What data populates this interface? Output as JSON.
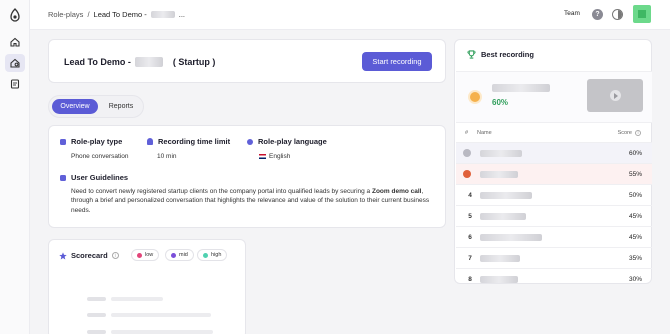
{
  "topbar": {
    "breadcrumb_root": "Role-plays",
    "breadcrumb_sep": "/",
    "breadcrumb_current": "Lead To Demo -",
    "breadcrumb_ellipsis": "...",
    "team_label": "Team",
    "help_label": "?"
  },
  "sidebar": {
    "items": [
      {
        "icon": "home-icon"
      },
      {
        "icon": "roleplay-icon",
        "active": true
      },
      {
        "icon": "document-icon"
      }
    ]
  },
  "header": {
    "title_prefix": "Lead To Demo -",
    "title_suffix": "( Startup )",
    "record_button": "Start recording"
  },
  "tabs": [
    {
      "label": "Overview",
      "active": true
    },
    {
      "label": "Reports",
      "active": false
    }
  ],
  "details": {
    "type_label": "Role-play type",
    "type_value": "Phone conversation",
    "limit_label": "Recording time limit",
    "limit_value": "10 min",
    "language_label": "Role-play language",
    "language_value": "English",
    "guidelines_label": "User Guidelines",
    "guidelines_before": "Need to convert newly registered startup clients on the company portal into qualified leads by securing a ",
    "guidelines_bold": "Zoom demo call",
    "guidelines_after": ", through a brief and personalized conversation that highlights the relevance and value of the solution to their current business needs."
  },
  "scorecard": {
    "title": "Scorecard",
    "legend": [
      {
        "label": "low",
        "color": "#e2457a"
      },
      {
        "label": "mid",
        "color": "#7b4fd9"
      },
      {
        "label": "high",
        "color": "#4fd1b0"
      }
    ]
  },
  "best": {
    "title": "Best recording",
    "score": "60%"
  },
  "leaderboard": {
    "col_rank": "#",
    "col_name": "Name",
    "col_score": "Score",
    "rows": [
      {
        "rank": "",
        "medal": "#b9b9c2",
        "score": "60%"
      },
      {
        "rank": "",
        "medal": "#e0603a",
        "score": "55%"
      },
      {
        "rank": "4",
        "score": "50%"
      },
      {
        "rank": "5",
        "score": "45%"
      },
      {
        "rank": "6",
        "score": "45%"
      },
      {
        "rank": "7",
        "score": "35%"
      },
      {
        "rank": "8",
        "score": "30%"
      }
    ]
  },
  "colors": {
    "accent": "#5b5bd6",
    "best_score": "#2f9e5a",
    "highlight_row": "#fdf1f1"
  }
}
